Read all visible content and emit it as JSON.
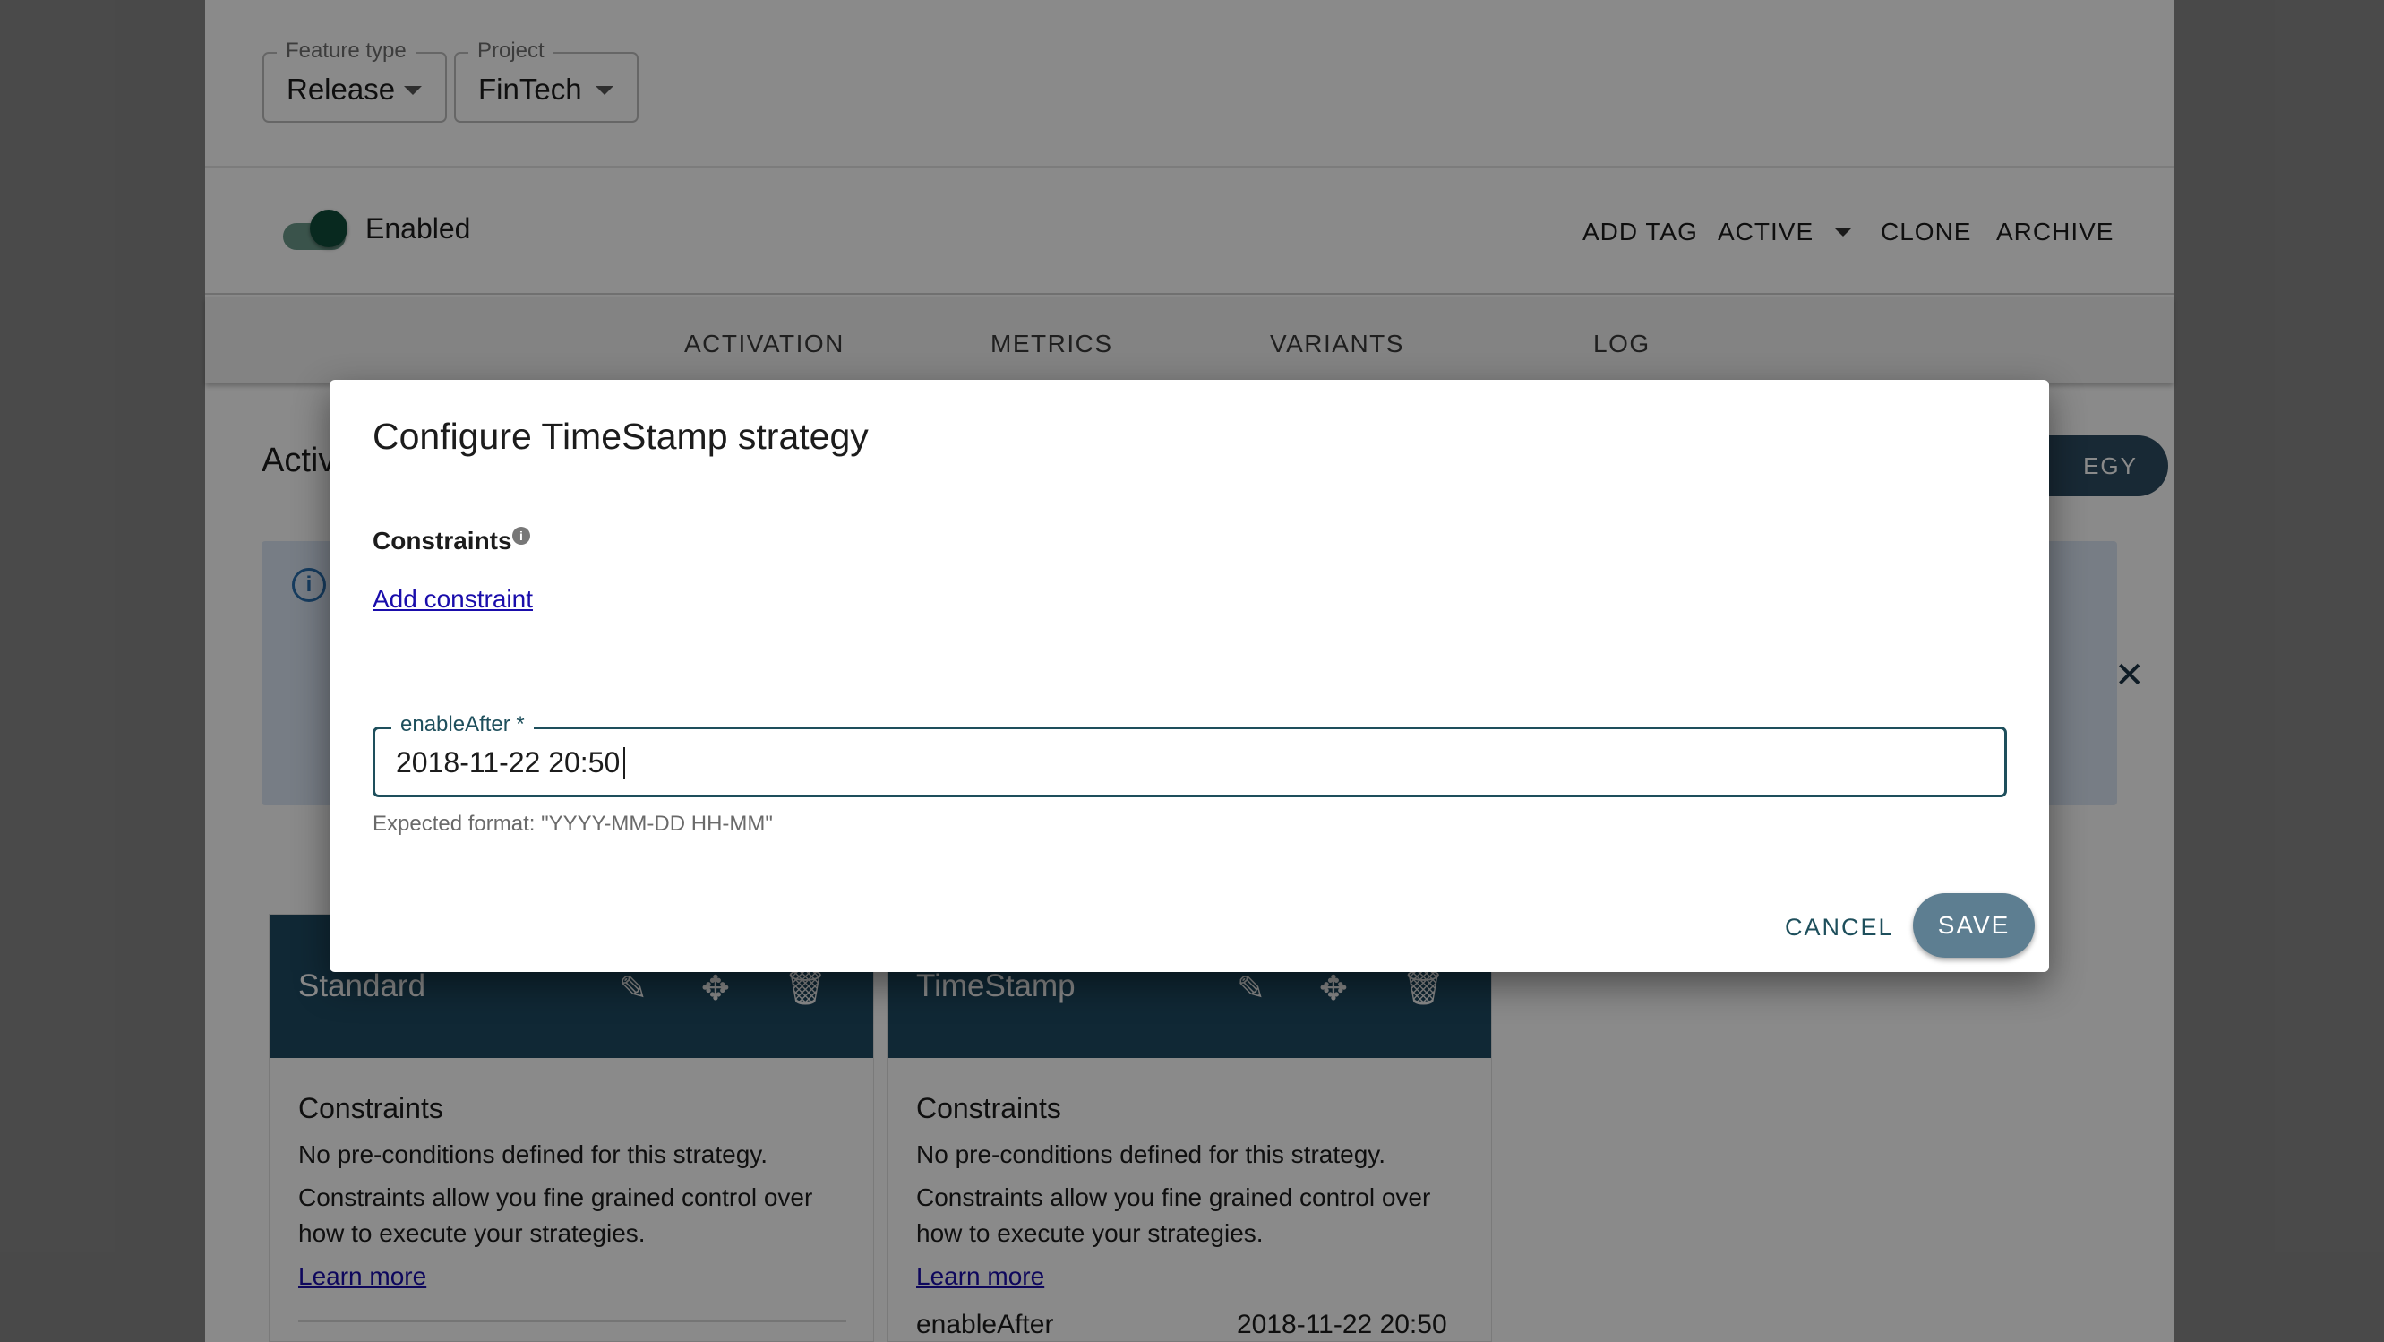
{
  "filters": {
    "feature_type": {
      "legend": "Feature type",
      "value": "Release"
    },
    "project": {
      "legend": "Project",
      "value": "FinTech"
    }
  },
  "toolbar": {
    "toggle_label": "Enabled",
    "toggle_on": true,
    "add_tag": "ADD TAG",
    "active": "ACTIVE",
    "clone": "CLONE",
    "archive": "ARCHIVE"
  },
  "tabs": [
    "ACTIVATION",
    "METRICS",
    "VARIANTS",
    "LOG"
  ],
  "activation": {
    "title_partial": "Activ",
    "add_strategy_partial": "EGY"
  },
  "cards": [
    {
      "title": "Standard",
      "constraints_heading": "Constraints",
      "no_constraints": "No pre-conditions defined for this strategy.",
      "constraints_help": "Constraints allow you fine grained control over how to execute your strategies.",
      "learn_more": "Learn more"
    },
    {
      "title": "TimeStamp",
      "constraints_heading": "Constraints",
      "no_constraints": "No pre-conditions defined for this strategy.",
      "constraints_help": "Constraints allow you fine grained control over how to execute your strategies.",
      "learn_more": "Learn more",
      "param_name": "enableAfter",
      "param_value": "2018-11-22 20:50"
    }
  ],
  "modal": {
    "title": "Configure TimeStamp strategy",
    "constraints_label": "Constraints",
    "add_constraint": "Add constraint",
    "field_legend": "enableAfter *",
    "field_value": "2018-11-22 20:50",
    "helper_text": "Expected format: \"YYYY-MM-DD HH-MM\"",
    "cancel": "CANCEL",
    "save": "SAVE"
  }
}
